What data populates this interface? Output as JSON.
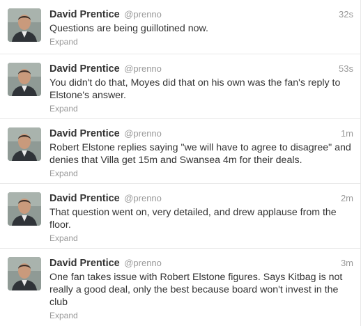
{
  "tweets": [
    {
      "name": "David Prentice",
      "username": "@prenno",
      "time": "32s",
      "text": "Questions are being guillotined now.",
      "expand": "Expand"
    },
    {
      "name": "David Prentice",
      "username": "@prenno",
      "time": "53s",
      "text": "You didn't do that, Moyes did that on his own was the fan's reply to Elstone's answer.",
      "expand": "Expand"
    },
    {
      "name": "David Prentice",
      "username": "@prenno",
      "time": "1m",
      "text": "Robert Elstone replies saying \"we will have to agree to disagree\" and denies that Villa get 15m and Swansea 4m for their deals.",
      "expand": "Expand"
    },
    {
      "name": "David Prentice",
      "username": "@prenno",
      "time": "2m",
      "text": "That question went on, very detailed, and drew applause from the floor.",
      "expand": "Expand"
    },
    {
      "name": "David Prentice",
      "username": "@prenno",
      "time": "3m",
      "text": "One fan takes issue with Robert Elstone figures. Says Kitbag is not really a good deal, only the best because board won't invest in the club",
      "expand": "Expand"
    }
  ]
}
